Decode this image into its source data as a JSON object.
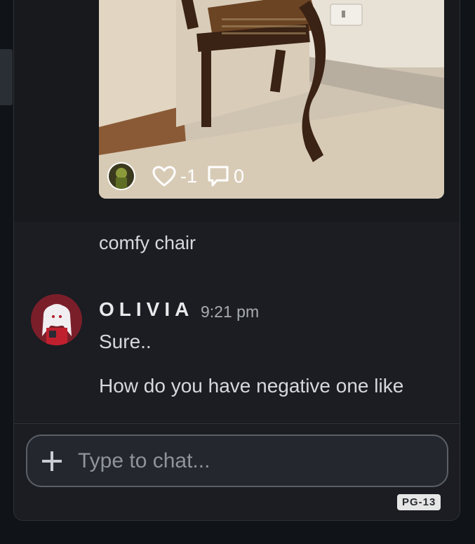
{
  "post": {
    "image_alt": "chair photo",
    "likes": "-1",
    "comments": "0",
    "caption": "comfy chair",
    "icons": {
      "like": "heart-icon",
      "comment": "comment-icon"
    }
  },
  "message": {
    "username": "OLIVIA",
    "time": "9:21 pm",
    "lines": [
      "Sure..",
      "How do you have negative one like"
    ]
  },
  "composer": {
    "placeholder": "Type to chat...",
    "add_icon": "plus-icon"
  },
  "rating": "PG-13",
  "colors": {
    "panel": "#1b1d22",
    "post_band": "#17191d",
    "text": "#d6d8dc",
    "muted": "#a7abb2"
  }
}
